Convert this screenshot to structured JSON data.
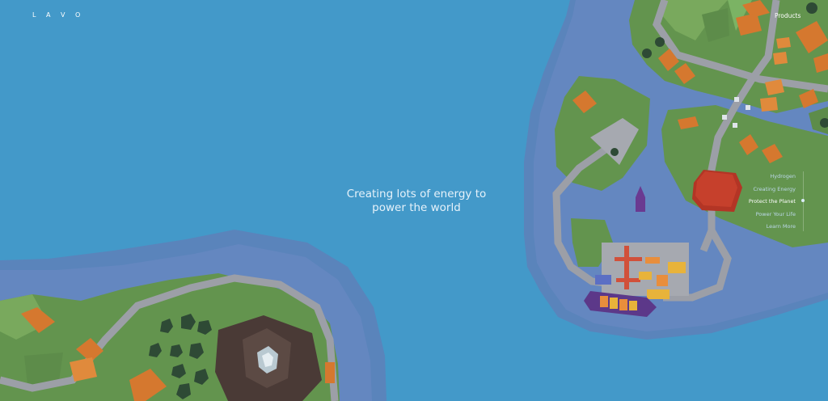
{
  "header": {
    "logo": "L A V O",
    "products_link": "Products"
  },
  "hero": {
    "headline_line1": "Creating lots of energy to",
    "headline_line2": "power the world"
  },
  "side_nav": {
    "items": [
      {
        "label": "Hydrogen",
        "active": false
      },
      {
        "label": "Creating Energy",
        "active": false
      },
      {
        "label": "Protect the Planet",
        "active": true
      },
      {
        "label": "Power Your Life",
        "active": false
      },
      {
        "label": "Learn More",
        "active": false
      }
    ]
  },
  "colors": {
    "ocean": "#4399c9",
    "shore": "#5683ba",
    "land": "#63944e",
    "roof": "#d5782f",
    "road": "#9c9fa7",
    "reactor": "#c6402c",
    "ship": "#5c3889",
    "mountain": "#4a3a36"
  },
  "icons": {
    "reactor": "reactor-icon",
    "ship": "cargo-ship-icon",
    "crane": "crane-icon"
  }
}
